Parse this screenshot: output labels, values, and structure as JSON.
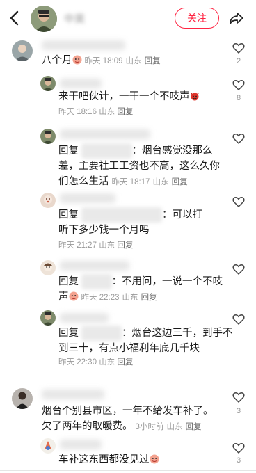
{
  "header": {
    "name": "中昊",
    "follow_label": "关注"
  },
  "comments": [
    {
      "text": "八个月",
      "time": "昨天 18:09",
      "location": "山东",
      "reply_label": "回复",
      "likes": "2"
    },
    {
      "text": "来干吧伙计，一干一个不吱声",
      "time": "昨天 18:16",
      "location": "山东",
      "reply_label": "回复",
      "likes": "8"
    },
    {
      "reply_prefix": "回复",
      "text_line1": "：烟台感觉没那么",
      "text_line2": "差，主要社工工资也不高，这么久你",
      "text_line3": "们怎么生活",
      "time": "昨天 18:17",
      "location": "山东",
      "reply_label": "回复"
    },
    {
      "reply_prefix": "回复",
      "text_line1": "：可以打",
      "text_line2": "听下多少钱一个月吗",
      "time": "昨天 21:27",
      "location": "山东",
      "reply_label": "回复"
    },
    {
      "reply_prefix": "回复",
      "text_line1": "：不用问，一说一个不吱",
      "text_line2": "声",
      "time": "昨天 22:23",
      "location": "山东",
      "reply_label": "回复"
    },
    {
      "reply_prefix": "回复",
      "text_line1": "：烟台这边三千，到手不",
      "text_line2": "到三十，有点小福利年底几千块",
      "time": "昨天 22:30",
      "location": "山东",
      "reply_label": "回复"
    },
    {
      "text_line1": "烟台个别县市区，一年不给发车补了。",
      "text_line2": "欠了两年的取暖费。",
      "time": "3小时前",
      "location": "山东",
      "reply_label": "回复",
      "likes": "3"
    },
    {
      "text": "车补这东西都没见过",
      "likes": "3"
    }
  ]
}
